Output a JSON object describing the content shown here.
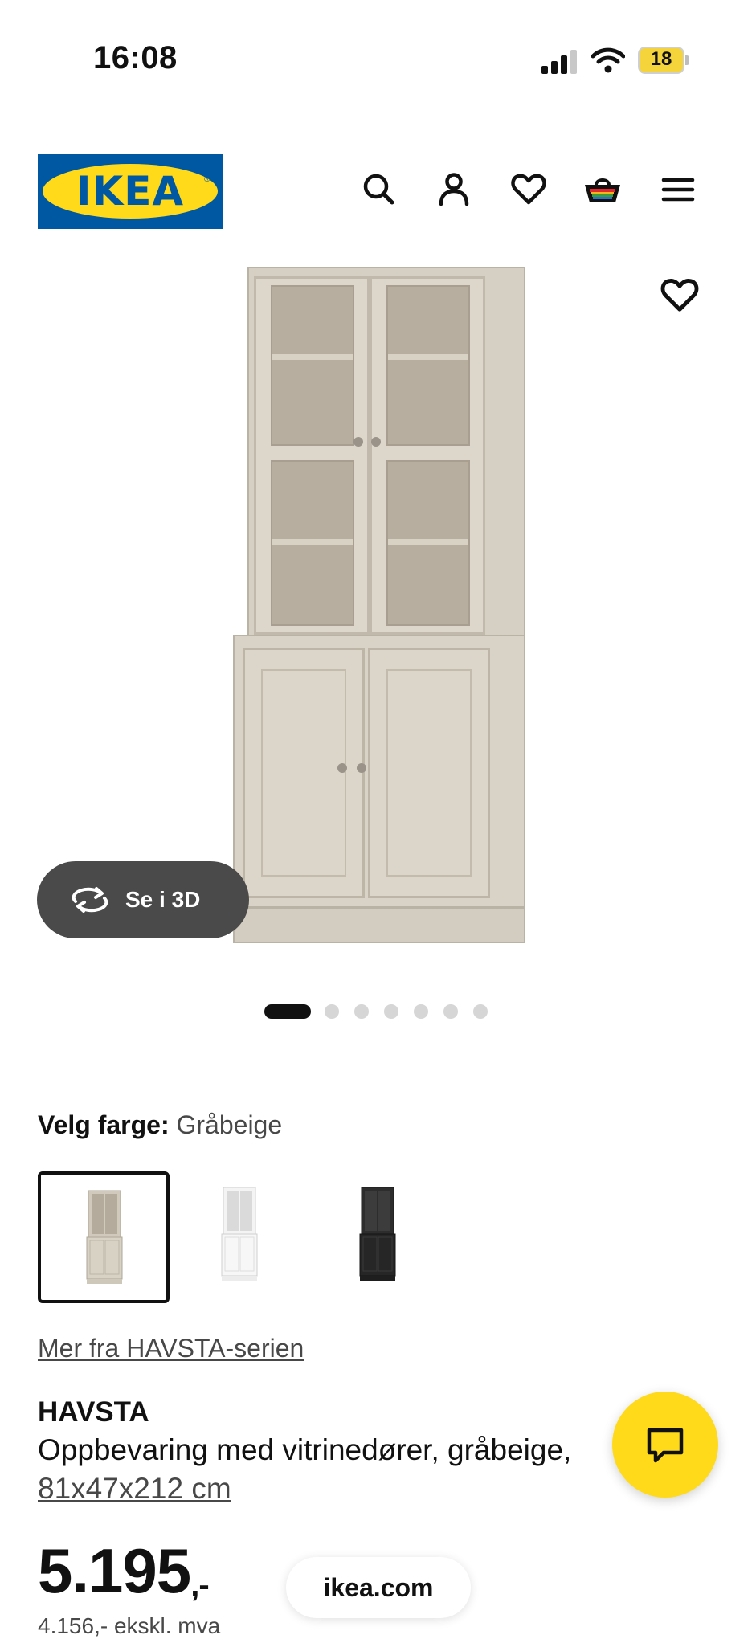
{
  "status_bar": {
    "time": "16:08",
    "battery": "18"
  },
  "header": {
    "logo_text": "IKEA",
    "icons": [
      "search-icon",
      "account-icon",
      "favourites-icon",
      "basket-icon",
      "menu-icon"
    ]
  },
  "gallery": {
    "view_3d_label": "Se i 3D",
    "image_count": 7,
    "active_index": 0
  },
  "color_picker": {
    "label": "Velg farge:",
    "selected": "Gråbeige",
    "options": [
      "gråbeige",
      "hvit",
      "svart"
    ]
  },
  "product": {
    "series_link": "Mer fra HAVSTA-serien",
    "name": "HAVSTA",
    "description": "Oppbevaring med vitrinedører, gråbeige,",
    "size": "81x47x212 cm",
    "price": "5.195",
    "price_suffix": ",-",
    "price_ex_vat": "4.156,- ekskl. mva"
  },
  "url_bar": {
    "domain": "ikea.com"
  },
  "colors": {
    "ikea_blue": "#0058a3",
    "ikea_yellow": "#ffda1a",
    "pill_dark": "#4a4a4a"
  }
}
